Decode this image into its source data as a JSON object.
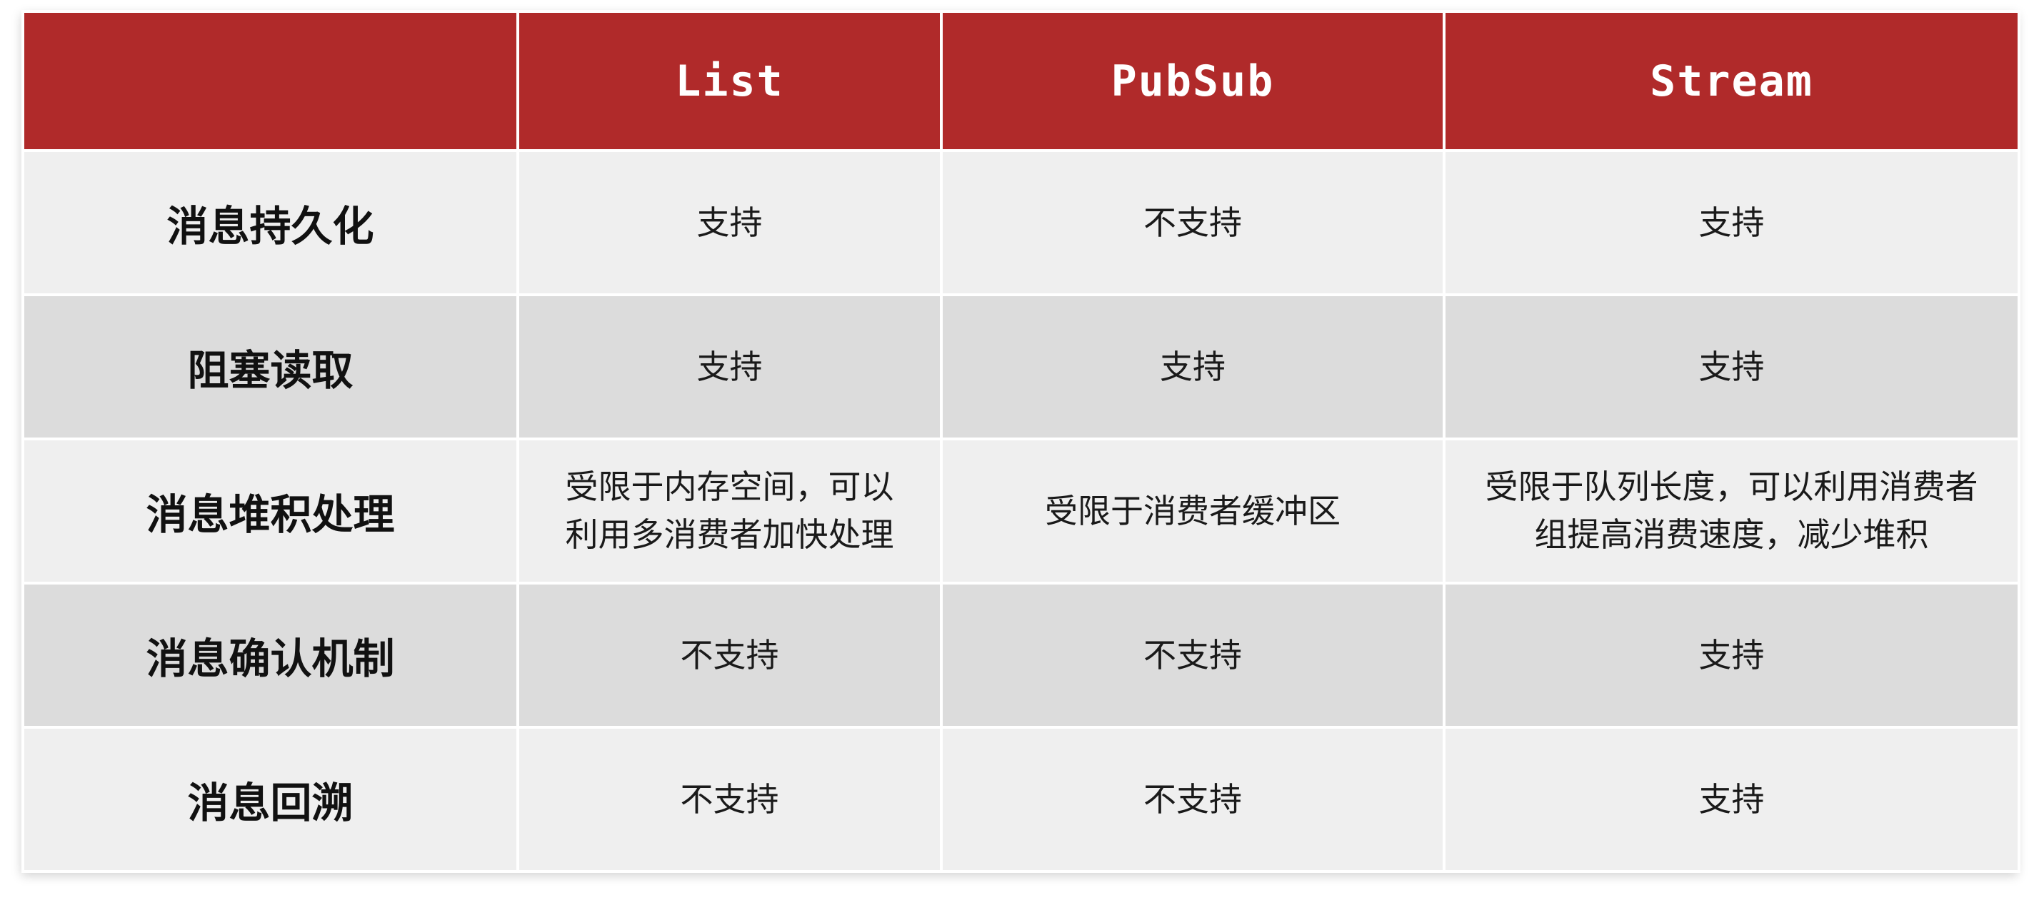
{
  "table": {
    "columns": [
      "",
      "List",
      "PubSub",
      "Stream"
    ],
    "rows": [
      {
        "label": "消息持久化",
        "cells": [
          "支持",
          "不支持",
          "支持"
        ]
      },
      {
        "label": "阻塞读取",
        "cells": [
          "支持",
          "支持",
          "支持"
        ]
      },
      {
        "label": "消息堆积处理",
        "cells": [
          "受限于内存空间，可以利用多消费者加快处理",
          "受限于消费者缓冲区",
          "受限于队列长度，可以利用消费者组提高消费速度，减少堆积"
        ]
      },
      {
        "label": "消息确认机制",
        "cells": [
          "不支持",
          "不支持",
          "支持"
        ]
      },
      {
        "label": "消息回溯",
        "cells": [
          "不支持",
          "不支持",
          "支持"
        ]
      }
    ]
  },
  "colors": {
    "header_bg": "#b02a2a",
    "header_text": "#ffffff",
    "row_odd_bg": "#efefef",
    "row_even_bg": "#dcdcdc"
  }
}
